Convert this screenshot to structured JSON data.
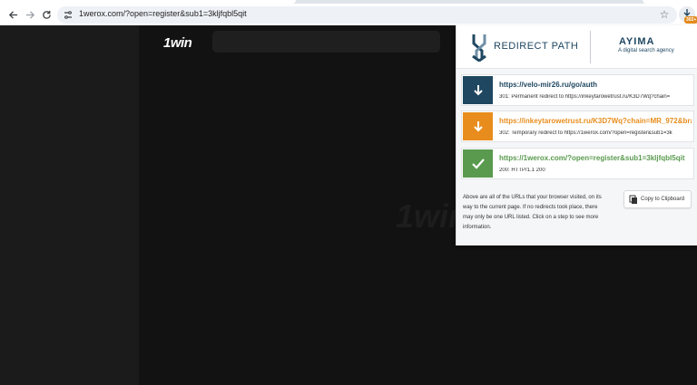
{
  "browser": {
    "url": "1werox.com/?open=register&sub1=3kljfqbl5qit",
    "extension_badge": "302+"
  },
  "site": {
    "logo": "1win",
    "watermark": "1win"
  },
  "popup": {
    "title": "REDIRECT PATH",
    "brand_name": "AYIMA",
    "brand_tagline": "A digital search agency",
    "steps": [
      {
        "url": "https://velo-mir26.ru/go/auth",
        "detail": "301: Permanent redirect to https://inkeytarowetrust.ru/K3D7Wq?chain=",
        "icon": "arrow-down-icon",
        "color": "#1f4761"
      },
      {
        "url": "https://inkeytarowetrust.ru/K3D7Wq?chain=MR_972&brand",
        "detail": "302: Temporary redirect to https://1werox.com/?open=register&sub1=3k",
        "icon": "arrow-down-icon",
        "color": "#e88d1d"
      },
      {
        "url": "https://1werox.com/?open=register&sub1=3kljfqbl5qit",
        "detail": "200: HTTP/1.1 200",
        "icon": "check-icon",
        "color": "#5a9a4f"
      }
    ],
    "info": "Above are all of the URLs that your browser visited, on its way to the current page. If no redirects took place, there may only be one URL listed. Click on a step to see more information.",
    "copy_label": "Copy to Clipboard"
  },
  "colors": {
    "brand": "#1f4761",
    "temporary": "#e88d1d",
    "success": "#5a9a4f"
  }
}
